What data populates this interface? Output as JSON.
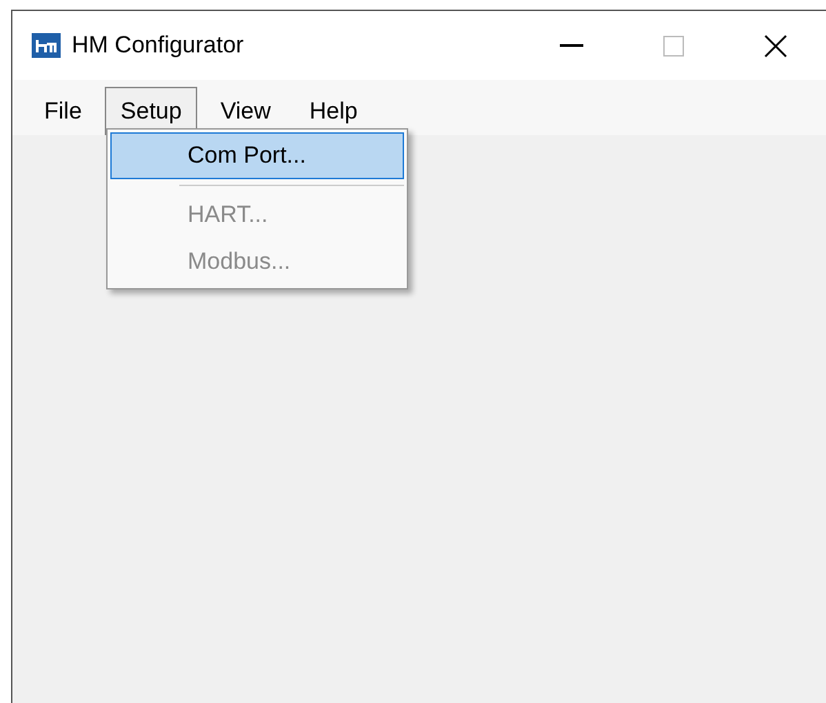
{
  "window": {
    "title": "HM Configurator"
  },
  "menu_bar": [
    {
      "label": "File",
      "selected": false
    },
    {
      "label": "Setup",
      "selected": true
    },
    {
      "label": "View",
      "selected": false
    },
    {
      "label": "Help",
      "selected": false
    }
  ],
  "dropdown": [
    {
      "kind": "item",
      "label": "Com Port...",
      "selected": true,
      "disabled": false
    },
    {
      "kind": "separator"
    },
    {
      "kind": "item",
      "label": "HART...",
      "selected": false,
      "disabled": true
    },
    {
      "kind": "item",
      "label": "Modbus...",
      "selected": false,
      "disabled": true
    }
  ]
}
